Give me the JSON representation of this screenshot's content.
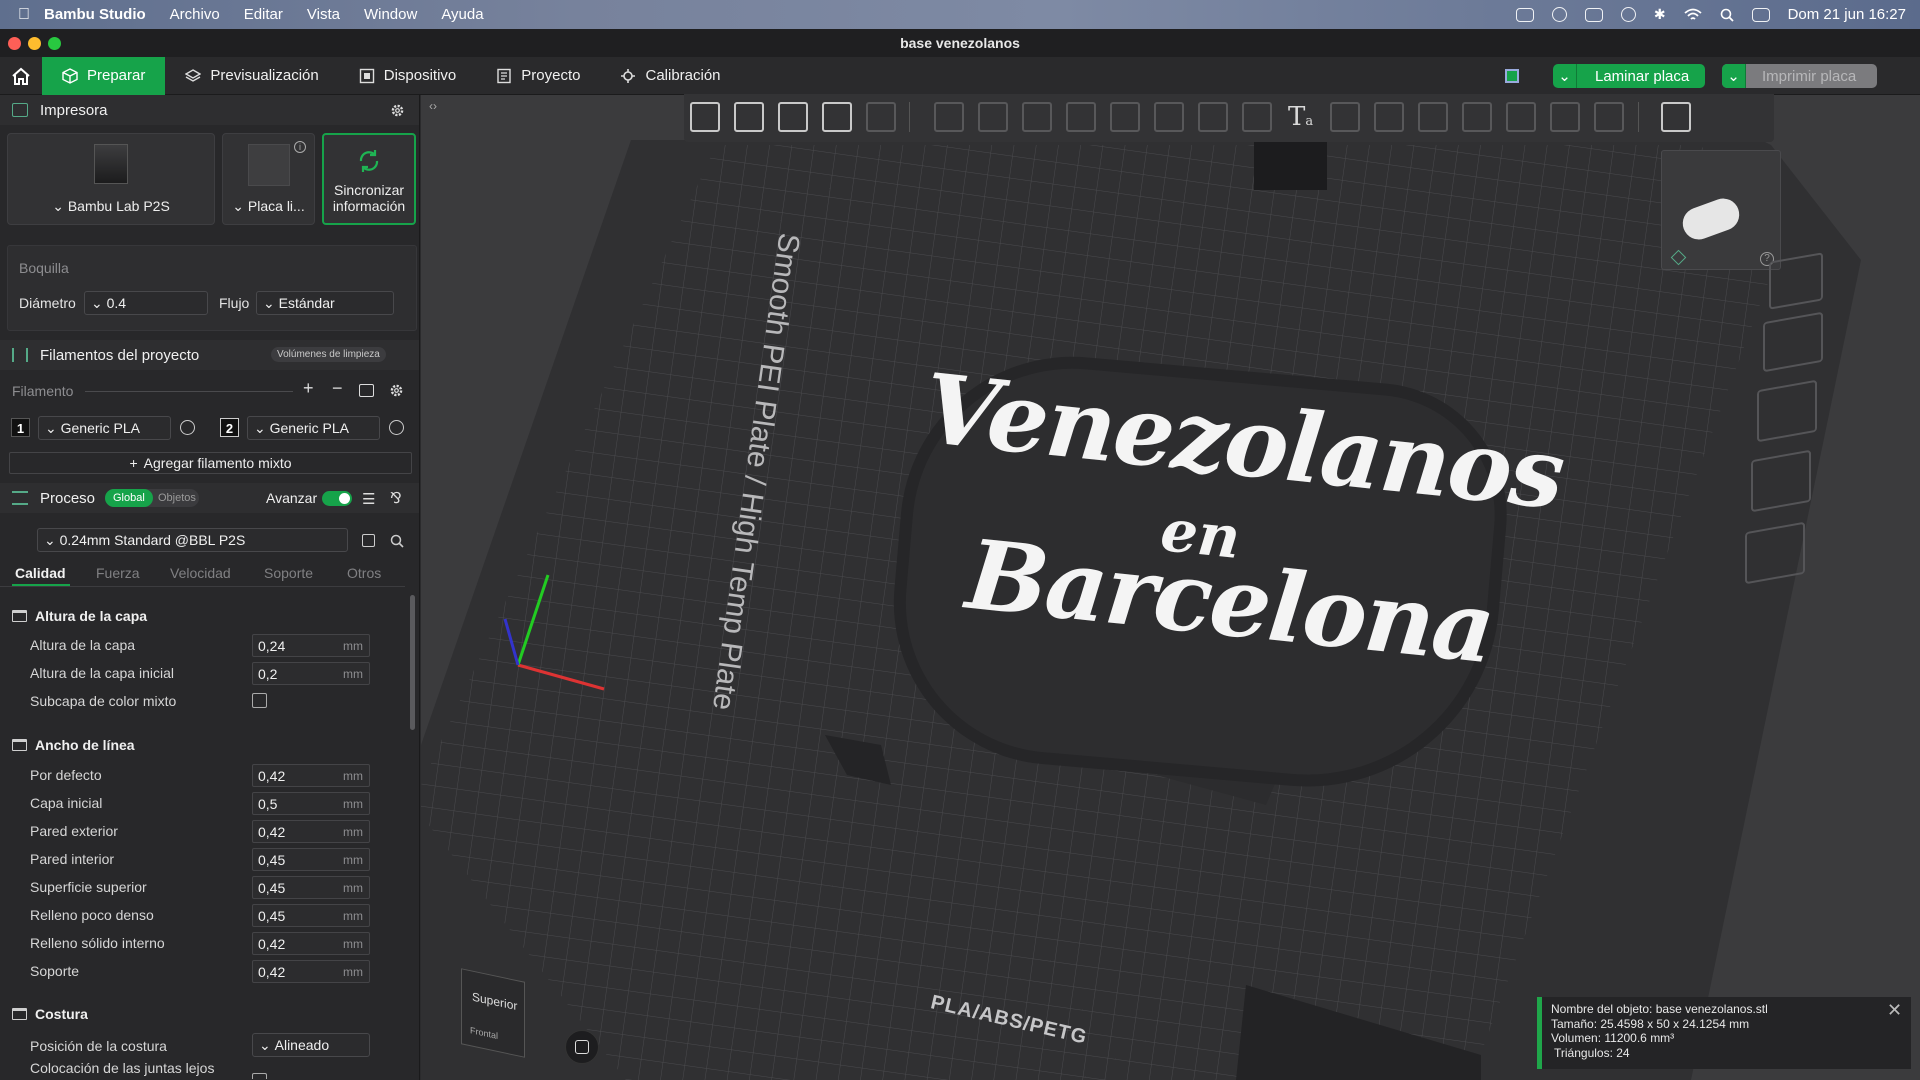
{
  "menubar": {
    "app": "Bambu Studio",
    "items": [
      "Archivo",
      "Editar",
      "Vista",
      "Window",
      "Ayuda"
    ],
    "clock": "Dom 21 jun  16:27"
  },
  "window": {
    "title": "base venezolanos"
  },
  "toolbar": {
    "tabs": [
      {
        "label": "Preparar",
        "icon": "cube-icon"
      },
      {
        "label": "Previsualización",
        "icon": "layers-icon"
      },
      {
        "label": "Dispositivo",
        "icon": "device-icon"
      },
      {
        "label": "Proyecto",
        "icon": "document-icon"
      },
      {
        "label": "Calibración",
        "icon": "calibration-icon"
      }
    ],
    "slice_label": "Laminar placa",
    "print_label": "Imprimir placa"
  },
  "printer": {
    "section": "Impresora",
    "model": "Bambu Lab P2S",
    "plate": "Placa li...",
    "sync": "Sincronizar información",
    "nozzle_label": "Boquilla",
    "diameter_label": "Diámetro",
    "diameter_value": "0.4",
    "flow_label": "Flujo",
    "flow_value": "Estándar"
  },
  "filaments": {
    "section": "Filamentos del proyecto",
    "purge_badge": "Volúmenes de limpieza",
    "header": "Filamento",
    "items": [
      {
        "num": "1",
        "name": "Generic PLA"
      },
      {
        "num": "2",
        "name": "Generic PLA"
      }
    ],
    "add_mixed": "Agregar filamento mixto"
  },
  "process": {
    "section": "Proceso",
    "global": "Global",
    "objects": "Objetos",
    "advance": "Avanzar",
    "profile": "0.24mm Standard @BBL P2S",
    "tabs": [
      "Calidad",
      "Fuerza",
      "Velocidad",
      "Soporte",
      "Otros"
    ],
    "groups": [
      {
        "title": "Altura de la capa",
        "rows": [
          {
            "label": "Altura de la capa",
            "value": "0,24",
            "unit": "mm"
          },
          {
            "label": "Altura de la capa inicial",
            "value": "0,2",
            "unit": "mm"
          },
          {
            "label": "Subcapa de color mixto",
            "value": "",
            "unit": ""
          }
        ]
      },
      {
        "title": "Ancho de línea",
        "rows": [
          {
            "label": "Por defecto",
            "value": "0,42",
            "unit": "mm"
          },
          {
            "label": "Capa inicial",
            "value": "0,5",
            "unit": "mm"
          },
          {
            "label": "Pared exterior",
            "value": "0,42",
            "unit": "mm"
          },
          {
            "label": "Pared interior",
            "value": "0,45",
            "unit": "mm"
          },
          {
            "label": "Superficie superior",
            "value": "0,45",
            "unit": "mm"
          },
          {
            "label": "Relleno poco denso",
            "value": "0,45",
            "unit": "mm"
          },
          {
            "label": "Relleno sólido interno",
            "value": "0,42",
            "unit": "mm"
          },
          {
            "label": "Soporte",
            "value": "0,42",
            "unit": "mm"
          }
        ]
      },
      {
        "title": "Costura",
        "rows": [
          {
            "label": "Posición de la costura",
            "value": "Alineado",
            "unit": ""
          },
          {
            "label": "Colocación de las juntas lejos",
            "value": "",
            "unit": ""
          }
        ]
      }
    ]
  },
  "viewport": {
    "plate_text": "Smooth PEI Plate / High Temp Plate",
    "plate_badge": "PLA/ABS/PETG",
    "logo_line1": "Venezolanos",
    "logo_line2": "en",
    "logo_line3": "Barcelona",
    "cube_top": "Superior",
    "cube_front": "Frontal"
  },
  "object_info": {
    "name": "Nombre del objeto: base venezolanos.stl",
    "size": "Tamaño: 25.4598 x 50 x 24.1254 mm",
    "volume": "Volumen: 11200.6 mm³",
    "triangles": "Triángulos: 24"
  },
  "colors": {
    "accent": "#16a34a",
    "panel": "#28282a",
    "viewport": "#3b3b3d"
  }
}
